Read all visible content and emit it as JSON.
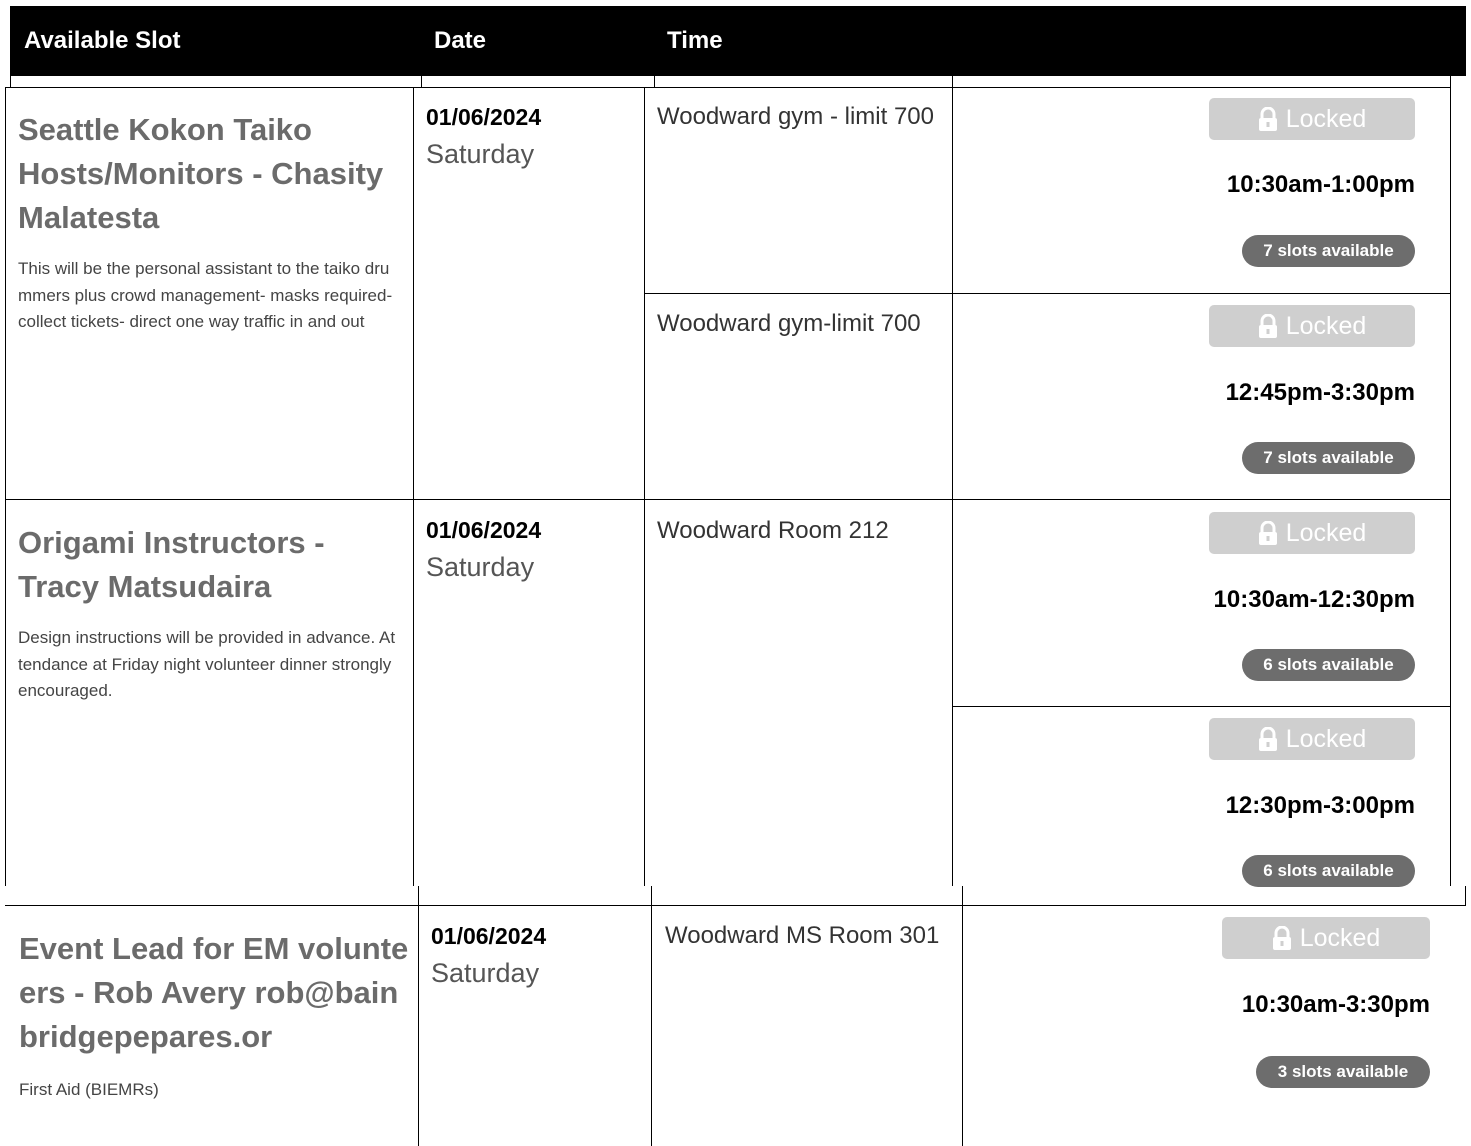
{
  "header": {
    "col_slot": "Available Slot",
    "col_date": "Date",
    "col_time": "Time"
  },
  "slots": [
    {
      "title": "Seattle Kokon Taiko Hosts/Monitors - Chasity Malatesta",
      "description": "This will be the personal assistant to the taiko drummers plus crowd management- masks required- collect tickets- direct one way traffic in and out",
      "date": "01/06/2024",
      "day": "Saturday",
      "entries": [
        {
          "location": "Woodward gym - limit 700",
          "lock_label": "Locked",
          "time": "10:30am-1:00pm",
          "availability": "7 slots available"
        },
        {
          "location": "Woodward gym-limit 700",
          "lock_label": "Locked",
          "time": "12:45pm-3:30pm",
          "availability": "7 slots available"
        }
      ]
    },
    {
      "title": "Origami Instructors - Tracy Matsudaira",
      "description": "Design instructions will be provided in advance. Attendance at Friday night volunteer dinner strongly encouraged.",
      "date": "01/06/2024",
      "day": "Saturday",
      "location": "Woodward Room 212",
      "entries": [
        {
          "lock_label": "Locked",
          "time": "10:30am-12:30pm",
          "availability": "6 slots available"
        },
        {
          "lock_label": "Locked",
          "time": "12:30pm-3:00pm",
          "availability": "6 slots available"
        }
      ]
    },
    {
      "title": "Event Lead for EM volunteers - Rob Avery rob@bainbridgepepares.or",
      "description": "First Aid (BIEMRs)",
      "date": "01/06/2024",
      "day": "Saturday",
      "location": "Woodward MS Room 301",
      "entries": [
        {
          "lock_label": "Locked",
          "time": "10:30am-3:30pm",
          "availability": "3 slots available"
        }
      ]
    }
  ],
  "colors": {
    "header_bg": "#000000",
    "title_gray": "#6b6b6b",
    "locked_bg": "#cfcfcf",
    "badge_bg": "#6d6d6d"
  },
  "icons": {
    "lock": "lock-icon"
  }
}
